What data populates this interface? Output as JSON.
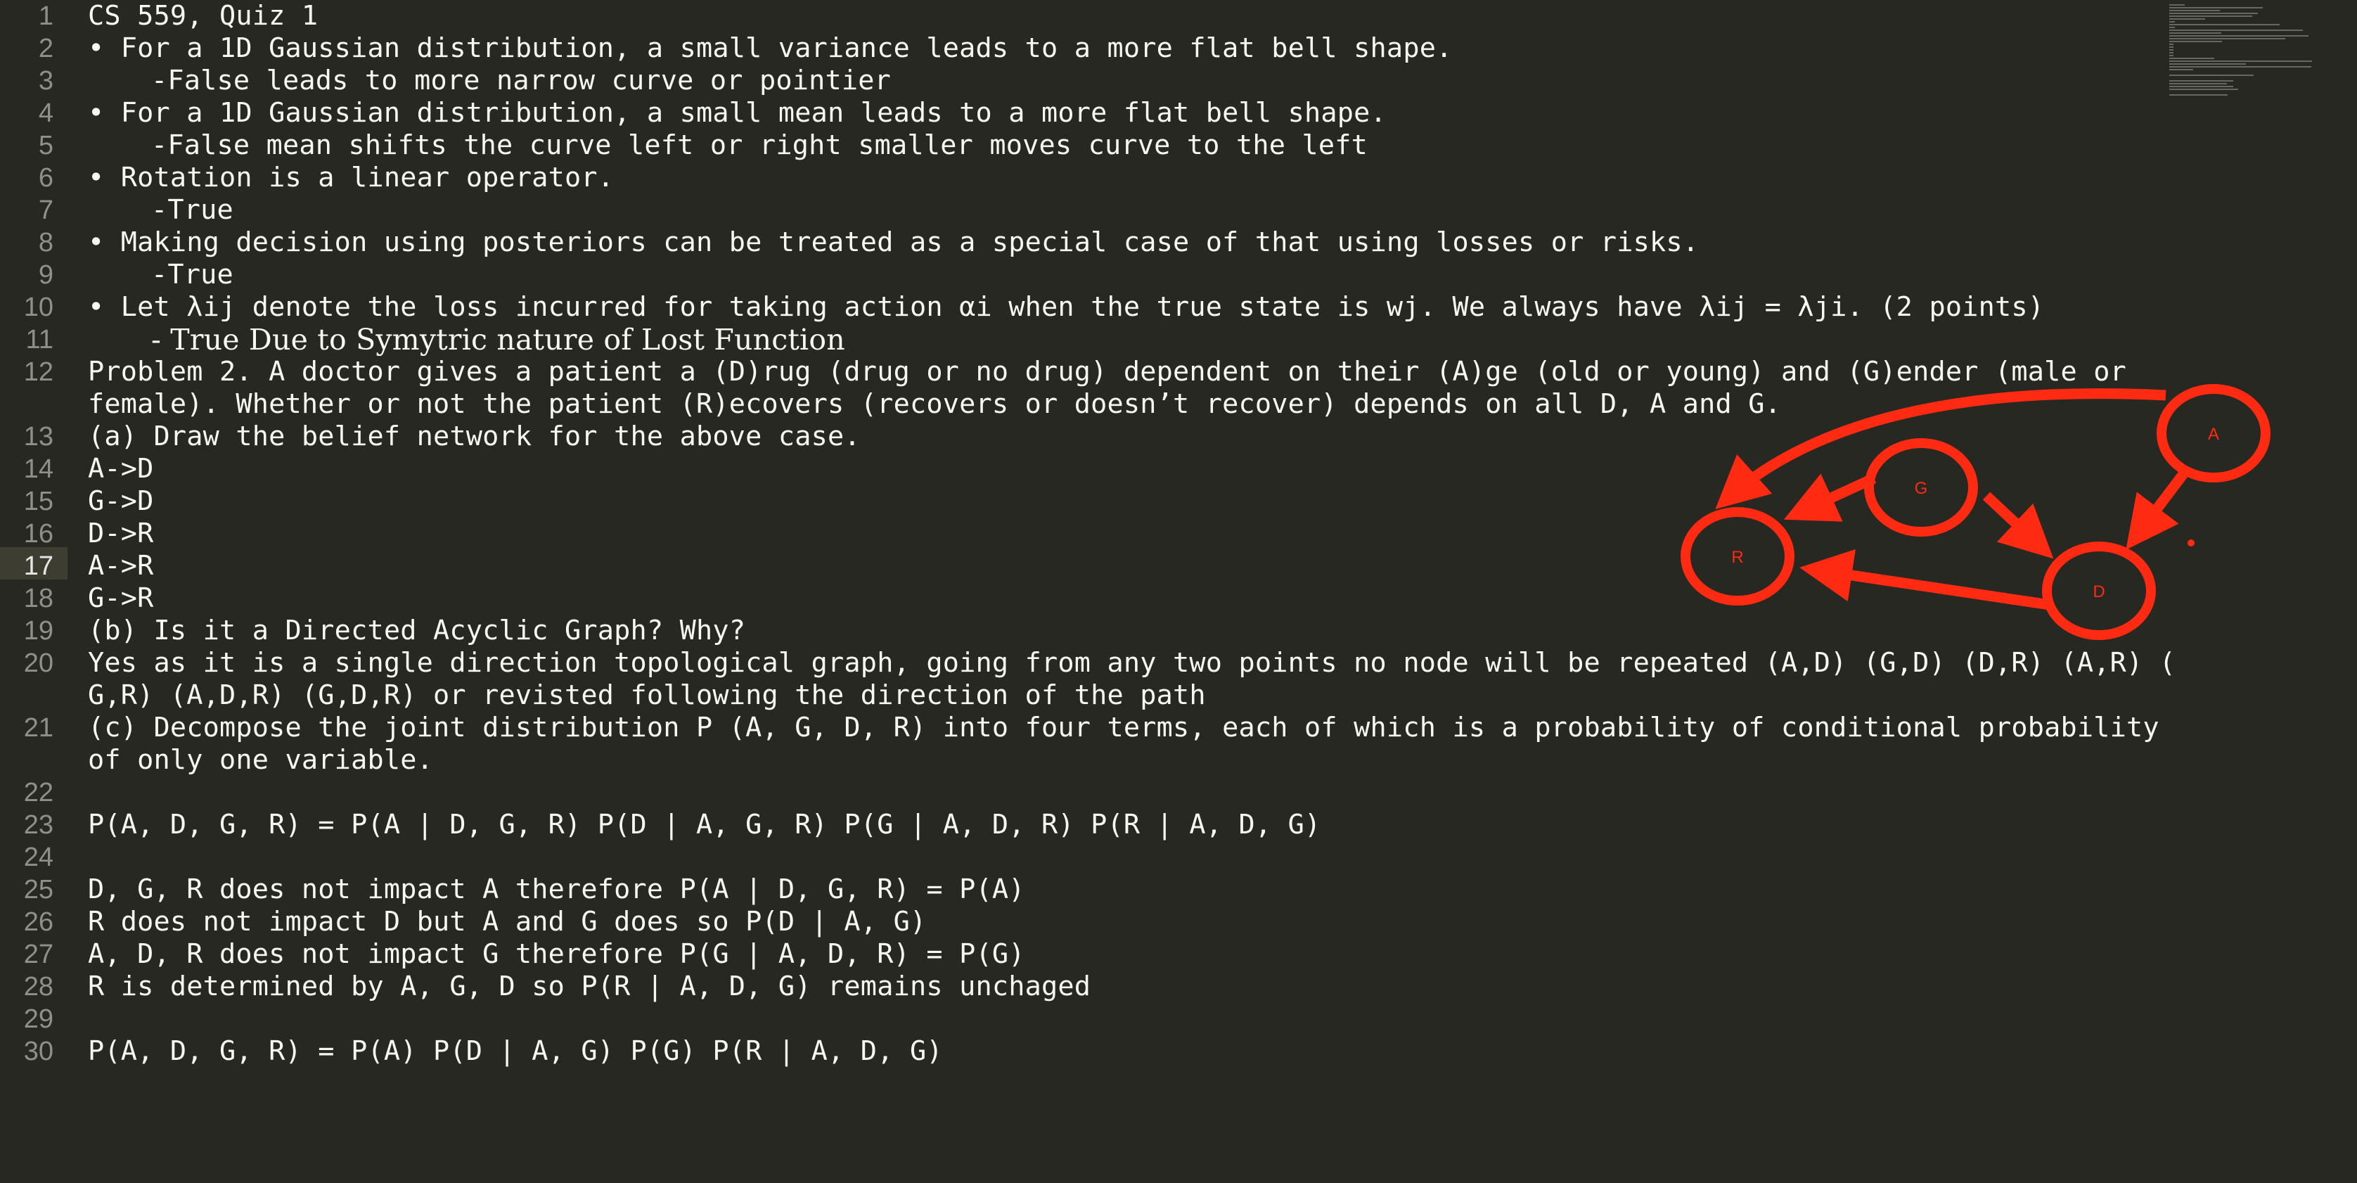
{
  "editor": {
    "active_line": 17,
    "theme_colors": {
      "background": "#272822",
      "text": "#f8f8f2",
      "line_number": "#8f908a",
      "annotation_red": "#ff2a12"
    }
  },
  "lines": [
    {
      "num": "1",
      "text": "CS 559, Quiz 1"
    },
    {
      "num": "2",
      "text": "• For a 1D Gaussian distribution, a small variance leads to a more flat bell shape."
    },
    {
      "num": "3",
      "text": "-False leads to more narrow curve or pointier"
    },
    {
      "num": "4",
      "text": "• For a 1D Gaussian distribution, a small mean leads to a more flat bell shape."
    },
    {
      "num": "5",
      "text": "-False mean shifts the curve left or right smaller moves curve to the left"
    },
    {
      "num": "6",
      "text": "• Rotation is a linear operator."
    },
    {
      "num": "7",
      "text": "-True"
    },
    {
      "num": "8",
      "text": "• Making decision using posteriors can be treated as a special case of that using losses or risks."
    },
    {
      "num": "9",
      "text": "-True"
    },
    {
      "num": "10",
      "text": "• Let λij denote the loss incurred for taking action αi when the true state is wj. We always have λij = λji. (2 points)"
    },
    {
      "num": "11",
      "text": "- True Due to Symytric nature of Lost Function"
    },
    {
      "num": "12",
      "text": "Problem 2. A doctor gives a patient a (D)rug (drug or no drug) dependent on their (A)ge (old or young) and (G)ender (male or"
    },
    {
      "num": "",
      "text": "female). Whether or not the patient (R)ecovers (recovers or doesn’t recover) depends on all D, A and G."
    },
    {
      "num": "13",
      "text": "(a) Draw the belief network for the above case."
    },
    {
      "num": "14",
      "text": "A->D"
    },
    {
      "num": "15",
      "text": "G->D"
    },
    {
      "num": "16",
      "text": "D->R"
    },
    {
      "num": "17",
      "text": "A->R"
    },
    {
      "num": "18",
      "text": "G->R"
    },
    {
      "num": "19",
      "text": "(b) Is it a Directed Acyclic Graph? Why?"
    },
    {
      "num": "20",
      "text": "Yes as it is a single direction topological graph, going from any two points no node will be repeated (A,D) (G,D) (D,R) (A,R) ("
    },
    {
      "num": "",
      "text": "G,R) (A,D,R) (G,D,R) or revisted following the direction of the path"
    },
    {
      "num": "21",
      "text": "(c) Decompose the joint distribution P (A, G, D, R) into four terms, each of which is a probability of conditional probability"
    },
    {
      "num": "",
      "text": "of only one variable."
    },
    {
      "num": "22",
      "text": ""
    },
    {
      "num": "23",
      "text": "P(A, D, G, R) = P(A | D, G, R) P(D | A, G, R) P(G | A, D, R) P(R | A, D, G)"
    },
    {
      "num": "24",
      "text": ""
    },
    {
      "num": "25",
      "text": "D, G, R does not impact A therefore P(A | D, G, R) = P(A)"
    },
    {
      "num": "26",
      "text": "R does not impact D but A and G does so P(D | A, G)"
    },
    {
      "num": "27",
      "text": "A, D, R does not impact G therefore P(G | A, D, R) = P(G)"
    },
    {
      "num": "28",
      "text": "R is determined by A, G, D so P(R | A, D, G) remains unchaged"
    },
    {
      "num": "29",
      "text": ""
    },
    {
      "num": "30",
      "text": "P(A, D, G, R) = P(A) P(D | A, G) P(G) P(R | A, D, G)"
    }
  ],
  "graph": {
    "nodes": [
      {
        "id": "A",
        "label": "A"
      },
      {
        "id": "G",
        "label": "G"
      },
      {
        "id": "R",
        "label": "R"
      },
      {
        "id": "D",
        "label": "D"
      }
    ],
    "edges": [
      "A->R",
      "A->D",
      "G->R",
      "G->D",
      "D->R"
    ]
  }
}
